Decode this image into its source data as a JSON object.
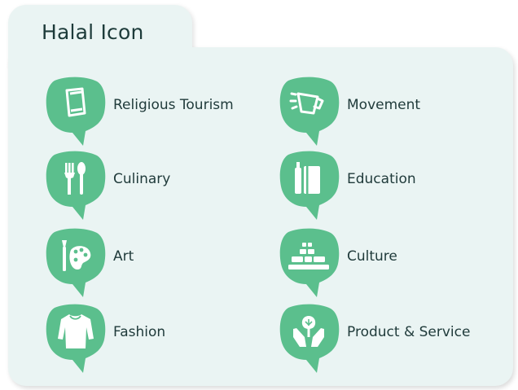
{
  "title": "Halal Icon",
  "colors": {
    "badge": "#5bbf8d",
    "panel": "#eaf4f3",
    "text": "#1f3a3a"
  },
  "items": [
    {
      "label": "Religious Tourism",
      "icon": "tablet-icon"
    },
    {
      "label": "Movement",
      "icon": "travel-cup-icon"
    },
    {
      "label": "Culinary",
      "icon": "fork-spoon-icon"
    },
    {
      "label": "Education",
      "icon": "book-icon"
    },
    {
      "label": "Art",
      "icon": "palette-icon"
    },
    {
      "label": "Culture",
      "icon": "stones-icon"
    },
    {
      "label": "Fashion",
      "icon": "shirt-icon"
    },
    {
      "label": "Product & Service",
      "icon": "hands-plant-icon"
    }
  ]
}
